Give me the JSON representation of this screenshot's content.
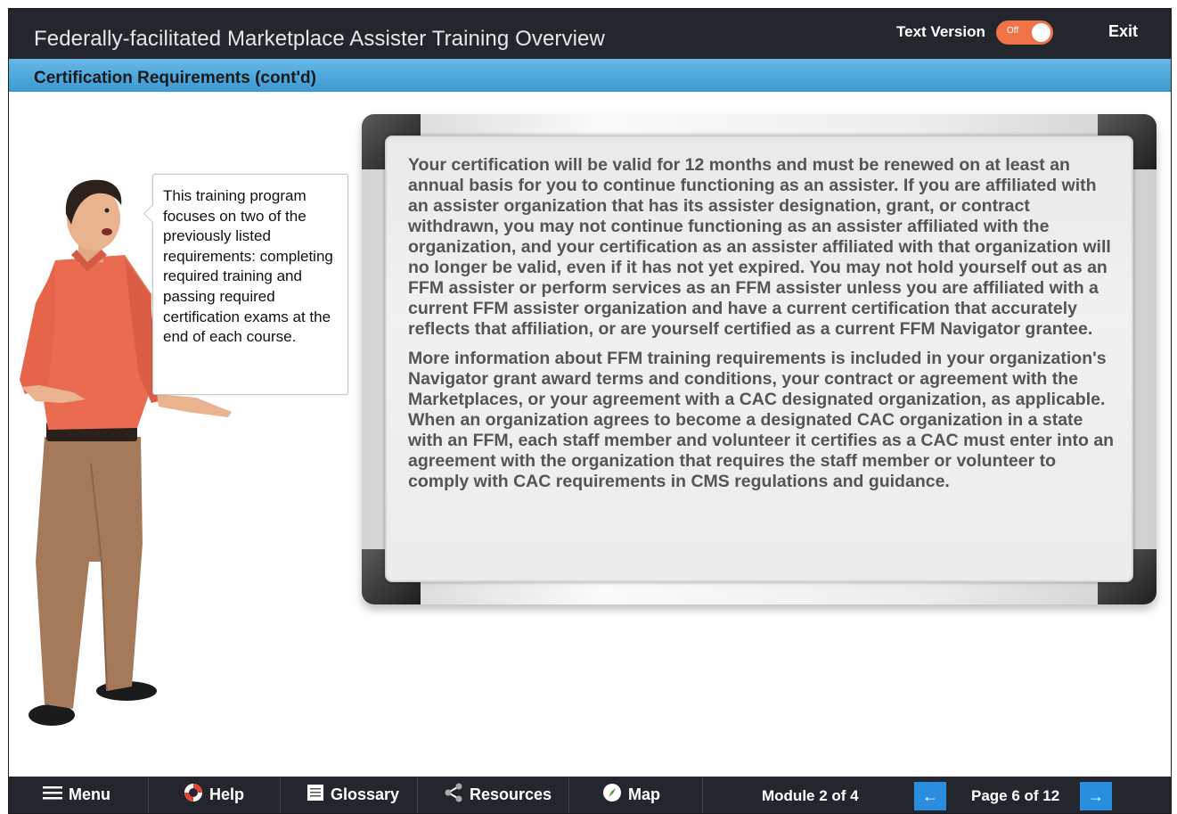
{
  "header": {
    "title": "Federally-facilitated Marketplace Assister Training Overview",
    "text_version_label": "Text Version",
    "toggle_state": "Off",
    "exit_label": "Exit"
  },
  "section": {
    "title": "Certification Requirements (cont'd)"
  },
  "bubble": {
    "text": "This training program focuses on two of the previously listed requirements: completing required training and passing required certification exams at the end of each course."
  },
  "board": {
    "paragraphs": [
      "Your certification will be valid for 12 months and must be renewed on at least an annual basis for you to continue functioning as an assister. If you are affiliated with an assister organization that has its assister designation, grant, or contract withdrawn, you may not continue functioning as an assister affiliated with the organization, and your certification as an assister affiliated with that organization will no longer be valid, even if it has not yet expired. You may not hold yourself out as an FFM assister or perform services as an FFM assister unless you are affiliated with a current FFM assister organization and have a current certification that accurately reflects that affiliation, or are yourself certified as a current FFM Navigator grantee.",
      "More information about FFM training requirements is included in your organization's Navigator grant award terms and conditions, your contract or agreement with the Marketplaces, or your agreement with a CAC designated organization, as applicable. When an organization agrees to become a designated CAC organization in a state with an FFM, each staff member and volunteer it certifies as a CAC must enter into an agreement with the organization that requires the staff member or volunteer to comply with CAC requirements in CMS regulations and guidance."
    ]
  },
  "footer": {
    "menu_label": "Menu",
    "help_label": "Help",
    "glossary_label": "Glossary",
    "resources_label": "Resources",
    "map_label": "Map",
    "module_text": "Module 2 of 4",
    "page_text": "Page 6 of 12"
  },
  "colors": {
    "topbar": "#23272d",
    "subbar": "#4aa8dd",
    "toggle": "#f07247",
    "nav_arrow": "#2a8ee0"
  }
}
